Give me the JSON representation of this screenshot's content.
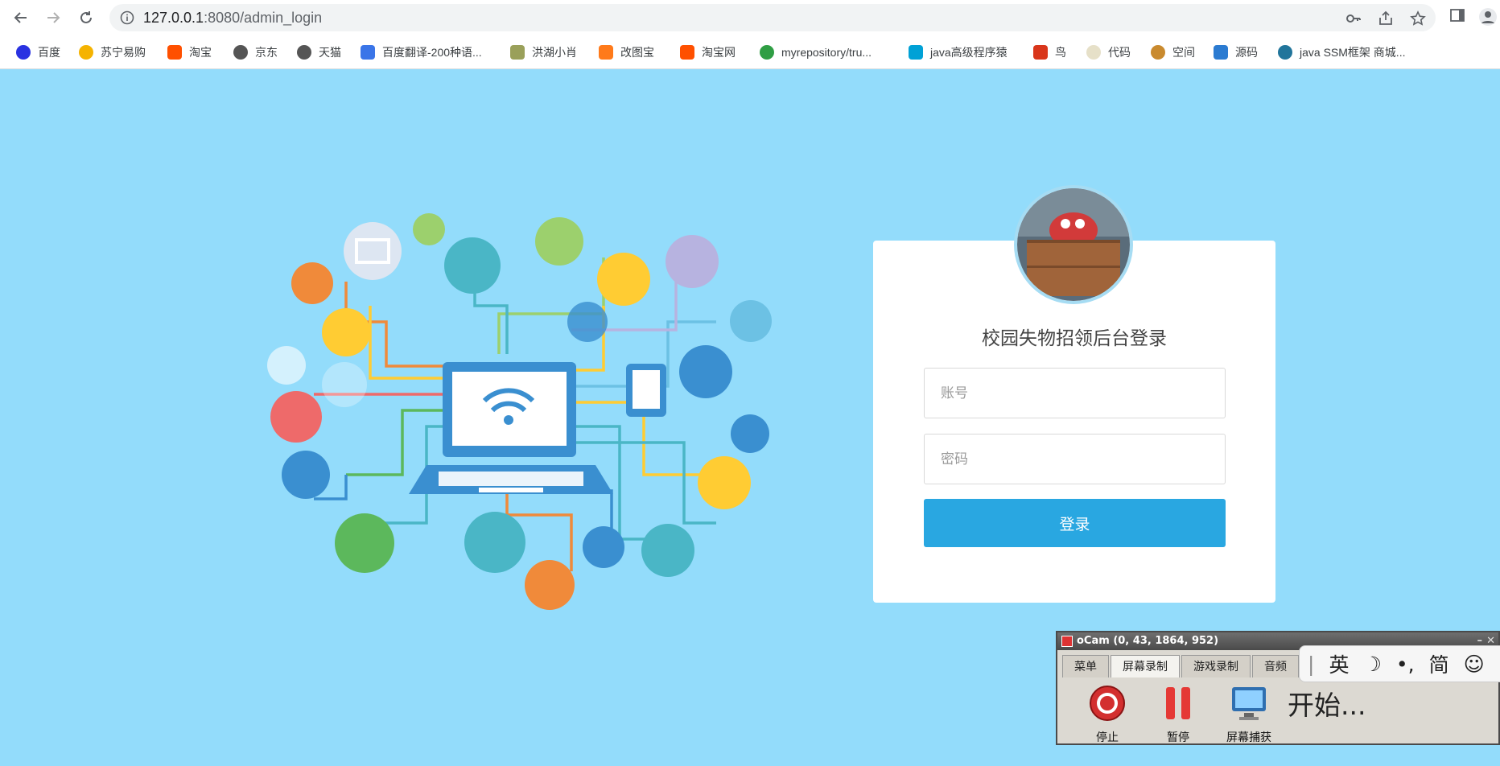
{
  "browser": {
    "url_host": "127.0.0.1",
    "url_path": ":8080/admin_login"
  },
  "bookmarks": [
    {
      "label": "百度",
      "color": "#2932e1"
    },
    {
      "label": "苏宁易购",
      "color": "#f5b301"
    },
    {
      "label": "淘宝",
      "color": "#ff5000"
    },
    {
      "label": "京东",
      "color": "#555555"
    },
    {
      "label": "天猫",
      "color": "#555555"
    },
    {
      "label": "百度翻译-200种语...",
      "color": "#3a75e8"
    },
    {
      "label": "洪湖小肖",
      "color": "#9aa05a"
    },
    {
      "label": "改图宝",
      "color": "#ff7a1a"
    },
    {
      "label": "淘宝网",
      "color": "#ff5000"
    },
    {
      "label": "myrepository/tru...",
      "color": "#2f9e44"
    },
    {
      "label": "java高级程序猿",
      "color": "#00a1d6"
    },
    {
      "label": "鸟",
      "color": "#d9361b"
    },
    {
      "label": "代码",
      "color": "#e6e0c8"
    },
    {
      "label": "空间",
      "color": "#c98a2e"
    },
    {
      "label": "源码",
      "color": "#2b7bd1"
    },
    {
      "label": "java SSM框架 商城...",
      "color": "#21759b"
    }
  ],
  "login": {
    "title": "校园失物招领后台登录",
    "username_placeholder": "账号",
    "password_placeholder": "密码",
    "submit_label": "登录"
  },
  "ocam": {
    "title": "oCam (0, 43, 1864, 952)",
    "tabs": [
      "菜单",
      "屏幕录制",
      "游戏录制",
      "音频"
    ],
    "tools": [
      "停止",
      "暂停",
      "屏幕捕获"
    ],
    "status": "开始..."
  },
  "ime": {
    "items": [
      "英",
      "☽",
      "•,",
      "简",
      "☺"
    ]
  },
  "colors": {
    "page_bg": "#93dcfb",
    "button_bg": "#29a7e1"
  }
}
